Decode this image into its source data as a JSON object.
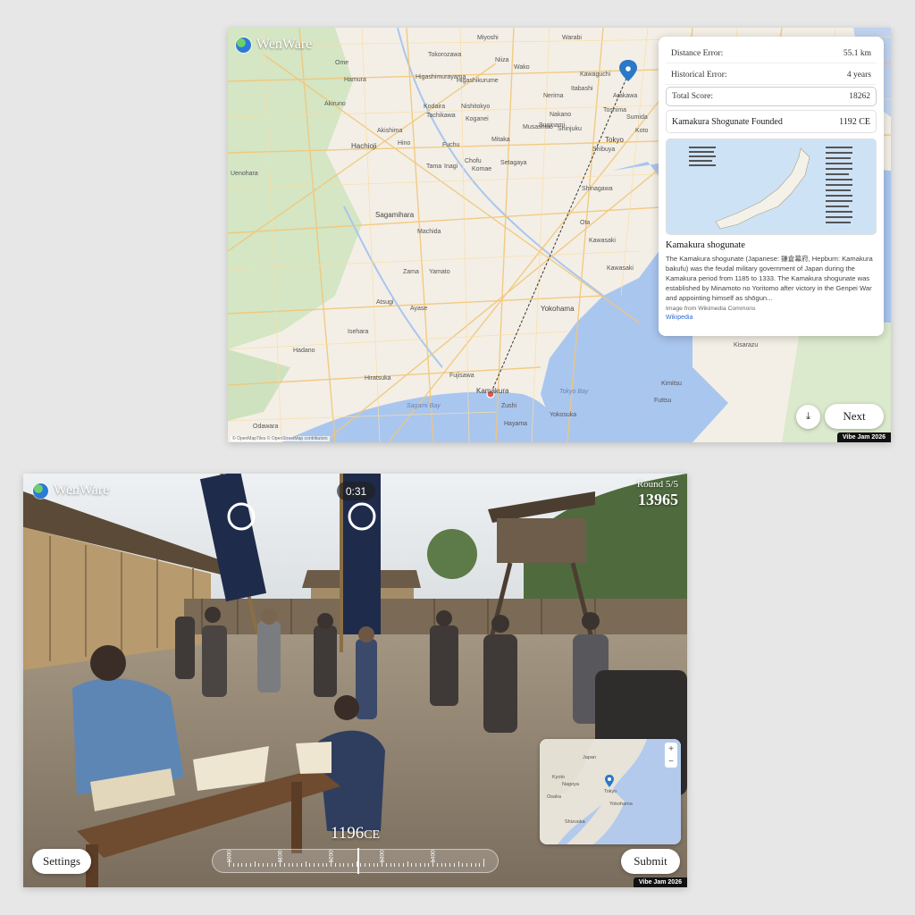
{
  "top_panel": {
    "logo": "WenWare",
    "stats": {
      "distance_label": "Distance Error:",
      "distance_value": "55.1 km",
      "historical_label": "Historical Error:",
      "historical_value": "4 years",
      "score_label": "Total Score:",
      "score_value": "18262"
    },
    "event": {
      "name": "Kamakura Shogunate Founded",
      "year": "1192 CE"
    },
    "wiki": {
      "title": "Kamakura shogunate",
      "text": "The Kamakura shogunate (Japanese: 鎌倉幕府, Hepburn: Kamakura bakufu) was the feudal military government of Japan during the Kamakura period from 1185 to 1333. The Kamakura shogunate was established by Minamoto no Yoritomo after victory in the Genpei War and appointing himself as shōgun...",
      "source": "Image from Wikimedia Commons",
      "link": "Wikipedia"
    },
    "next_label": "Next",
    "download_icon": "download-icon",
    "badge": "Vibe Jam 2026",
    "attribution": "© OpenMapTiles © OpenStreetMap contributors",
    "map_labels": [
      "Ome",
      "Hamura",
      "Akiruno",
      "Hachioji",
      "Hino",
      "Fuchu",
      "Chofu",
      "Tama",
      "Inagi",
      "Komae",
      "Setagaya",
      "Sagamihara",
      "Machida",
      "Zama",
      "Yamato",
      "Atsugi",
      "Ayase",
      "Isehara",
      "Hadano",
      "Hiratsuka",
      "Fujisawa",
      "Kamakura",
      "Zushi",
      "Yokosuka",
      "Hayama",
      "Odawara",
      "Yokohama",
      "Kawasaki",
      "Ota",
      "Shinagawa",
      "Tokyo",
      "Shibuya",
      "Shinjuku",
      "Nerima",
      "Itabashi",
      "Arakawa",
      "Sumida",
      "Koto",
      "Tokorozawa",
      "Niiza",
      "Wako",
      "Kawaguchi",
      "Warabi",
      "Higashimurayama",
      "Higashikurume",
      "Nishitokyo",
      "Kodaira",
      "Koganei",
      "Mitaka",
      "Musashino",
      "Suginami",
      "Nakano",
      "Toshima",
      "Kisarazu",
      "Kimitsu",
      "Futtsu",
      "Miyoshi",
      "Akishima",
      "Tachikawa",
      "Uenohara",
      "Kawasaki"
    ],
    "map_water_labels": [
      "Tokyo Bay",
      "Sagami Bay"
    ]
  },
  "bottom_panel": {
    "logo": "WenWare",
    "timer": "0:31",
    "round_label": "Round 5/5",
    "score": "13965",
    "year_value": "1196",
    "year_era": "CE",
    "slider_labels": [
      "1000",
      "1100",
      "1200",
      "1300",
      "1400"
    ],
    "settings_label": "Settings",
    "submit_label": "Submit",
    "badge": "Vibe Jam 2026",
    "minimap_labels": [
      "Japan",
      "Tokyo",
      "Nagoya",
      "Osaka",
      "Kyoto",
      "Shizuoka",
      "Yokohama"
    ]
  },
  "colors": {
    "map_land": "#f3efe6",
    "map_water": "#a9c6ef",
    "road": "#f4c87a",
    "pin": "#2a78c8",
    "guess": "#e25a4a"
  }
}
